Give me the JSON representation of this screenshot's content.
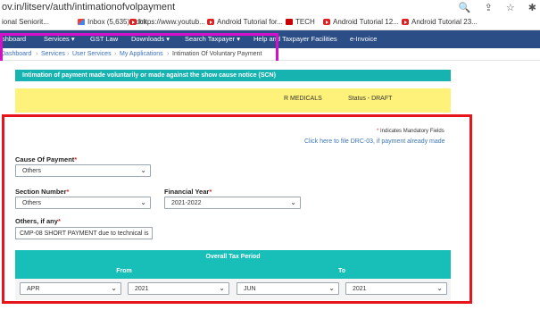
{
  "browser": {
    "url": "ov.in/litserv/auth/intimationofvolpayment",
    "bookmarks": [
      {
        "label": "ional Seniorit...",
        "icon": "none"
      },
      {
        "label": "Inbox (5,635) - dck...",
        "icon": "gmail-icon"
      },
      {
        "label": "https://www.youtub...",
        "icon": "youtube-icon"
      },
      {
        "label": "Android Tutorial for...",
        "icon": "youtube-icon"
      },
      {
        "label": "TECH",
        "icon": "tech-icon"
      },
      {
        "label": "Android Tutorial 12...",
        "icon": "youtube-icon"
      },
      {
        "label": "Android Tutorial 23...",
        "icon": "youtube-icon"
      }
    ]
  },
  "nav": {
    "dashboard": "shboard",
    "services": "Services ▾",
    "gst_law": "GST Law",
    "downloads": "Downloads ▾",
    "search_taxpayer": "Search Taxpayer ▾",
    "help": "Help and Taxpayer Facilities",
    "einvoice": "e-Invoice"
  },
  "breadcrumb": {
    "dashboard": "Dashboard",
    "services": "Services",
    "user_services": "User Services",
    "my_applications": "My Applications",
    "current": "Intimation Of Voluntary Payment"
  },
  "page": {
    "header": "Intimation of payment made voluntarily or made against the show cause notice (SCN)",
    "trade_name": "R MEDICALS",
    "status": "Status - DRAFT",
    "mandatory_note": "Indicates Mandatory Fields",
    "drc_link": "Click here to file DRC-03, if payment already made"
  },
  "form": {
    "cause_label": "Cause Of Payment",
    "cause_value": "Others",
    "section_label": "Section Number",
    "section_value": "Others",
    "fy_label": "Financial Year",
    "fy_value": "2021-2022",
    "others_label": "Others, if any",
    "others_value": "CMP-08 SHORT PAYMENT due to technical is"
  },
  "tax_period": {
    "title": "Overall Tax Period",
    "from_label": "From",
    "to_label": "To",
    "from_month": "APR",
    "from_year": "2021",
    "to_month": "JUN",
    "to_year": "2021"
  },
  "colors": {
    "nav": "#2c4e86",
    "teal": "#18bfb8",
    "highlight_red": "#e8141c",
    "highlight_pink": "#d40ec9"
  }
}
